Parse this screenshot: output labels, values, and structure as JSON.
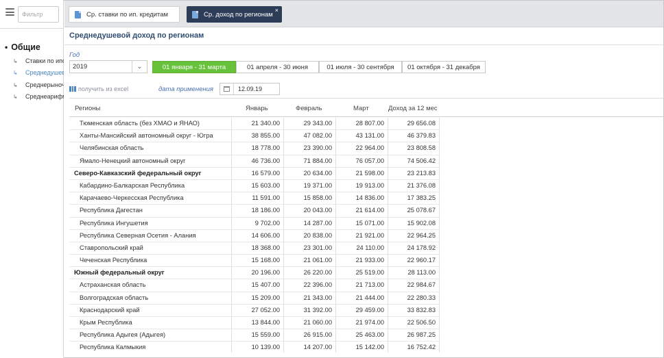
{
  "sidebar": {
    "filter_placeholder": "Фильтр",
    "group_title": "Общие",
    "group_bullet": "•",
    "items": [
      {
        "label": "Ставки по ипотечным кредитам"
      },
      {
        "label": "Среднедушевой доход по регионам"
      },
      {
        "label": "Среднерыночная стоимость"
      },
      {
        "label": "Среднеарифметическое"
      }
    ],
    "active_index": 1
  },
  "tabs": [
    {
      "label": "Ср. ставки по ип. кредитам",
      "active": false
    },
    {
      "label": "Ср. доход по регионам",
      "active": true,
      "close": "×"
    }
  ],
  "page": {
    "title": "Среднедушевой доход по регионам",
    "year_label": "Год",
    "year_value": "2019",
    "periods": [
      {
        "label": "01 января - 31 марта",
        "active": true
      },
      {
        "label": "01 апреля - 30 июня",
        "active": false
      },
      {
        "label": "01 июля - 30 сентября",
        "active": false
      },
      {
        "label": "01 октября - 31 декабря",
        "active": false
      }
    ],
    "excel_label": "получить из excel",
    "date_label": "дата применения",
    "date_value": "12.09.19"
  },
  "table": {
    "columns": [
      "Регионы",
      "Январь",
      "Февраль",
      "Март",
      "Доход за 12 мес"
    ],
    "rows": [
      {
        "name": "Тюменская область (без ХМАО и ЯНАО)",
        "bold": false,
        "v": [
          "21 340.00",
          "29 343.00",
          "28 807.00",
          "29 656.08"
        ]
      },
      {
        "name": "Ханты-Мансийский автономный округ - Югра",
        "bold": false,
        "v": [
          "38 855.00",
          "47 082.00",
          "43 131.00",
          "46 379.83"
        ]
      },
      {
        "name": "Челябинская область",
        "bold": false,
        "v": [
          "18 778.00",
          "23 390.00",
          "22 964.00",
          "23 808.58"
        ]
      },
      {
        "name": "Ямало-Ненецкий автономный округ",
        "bold": false,
        "v": [
          "46 736.00",
          "71 884.00",
          "76 057.00",
          "74 506.42"
        ]
      },
      {
        "name": "Северо-Кавказский федеральный округ",
        "bold": true,
        "v": [
          "16 579.00",
          "20 634.00",
          "21 598.00",
          "23 213.83"
        ]
      },
      {
        "name": "Кабардино-Балкарская Республика",
        "bold": false,
        "v": [
          "15 603.00",
          "19 371.00",
          "19 913.00",
          "21 376.08"
        ]
      },
      {
        "name": "Карачаево-Черкесская Республика",
        "bold": false,
        "v": [
          "11 591.00",
          "15 858.00",
          "14 836.00",
          "17 383.25"
        ]
      },
      {
        "name": "Республика Дагестан",
        "bold": false,
        "v": [
          "18 186.00",
          "20 043.00",
          "21 614.00",
          "25 078.67"
        ]
      },
      {
        "name": "Республика Ингушетия",
        "bold": false,
        "v": [
          "9 702.00",
          "14 287.00",
          "15 071.00",
          "15 902.08"
        ]
      },
      {
        "name": "Республика Северная Осетия - Алания",
        "bold": false,
        "v": [
          "14 606.00",
          "20 838.00",
          "21 921.00",
          "22 964.25"
        ]
      },
      {
        "name": "Ставропольский край",
        "bold": false,
        "v": [
          "18 368.00",
          "23 301.00",
          "24 110.00",
          "24 178.92"
        ]
      },
      {
        "name": "Чеченская Республика",
        "bold": false,
        "v": [
          "15 168.00",
          "21 061.00",
          "21 933.00",
          "22 960.17"
        ]
      },
      {
        "name": "Южный федеральный округ",
        "bold": true,
        "v": [
          "20 196.00",
          "26 220.00",
          "25 519.00",
          "28 113.00"
        ]
      },
      {
        "name": "Астраханская область",
        "bold": false,
        "v": [
          "15 407.00",
          "22 396.00",
          "21 713.00",
          "22 984.67"
        ]
      },
      {
        "name": "Волгоградская область",
        "bold": false,
        "v": [
          "15 209.00",
          "21 343.00",
          "21 444.00",
          "22 280.33"
        ]
      },
      {
        "name": "Краснодарский край",
        "bold": false,
        "v": [
          "27 052.00",
          "31 392.00",
          "29 459.00",
          "33 832.83"
        ]
      },
      {
        "name": "Крым Республика",
        "bold": false,
        "v": [
          "13 844.00",
          "21 060.00",
          "21 974.00",
          "22 506.50"
        ]
      },
      {
        "name": "Республика Адыгея (Адыгея)",
        "bold": false,
        "v": [
          "15 559.00",
          "26 915.00",
          "25 463.00",
          "26 987.25"
        ]
      },
      {
        "name": "Республика Калмыкия",
        "bold": false,
        "v": [
          "10 139.00",
          "14 207.00",
          "15 142.00",
          "16 752.42"
        ]
      }
    ]
  },
  "icons": {
    "menu": "hamburger-icon",
    "tab_doc": "document-icon",
    "caret": "chevron-down-icon",
    "excel": "table-icon",
    "calendar": "calendar-icon",
    "arrow": "↳"
  },
  "colors": {
    "tab_active_bg": "#2e3d57",
    "period_active_bg": "#67c23a",
    "title_color": "#2e4d73",
    "link_color": "#4a86c6"
  }
}
